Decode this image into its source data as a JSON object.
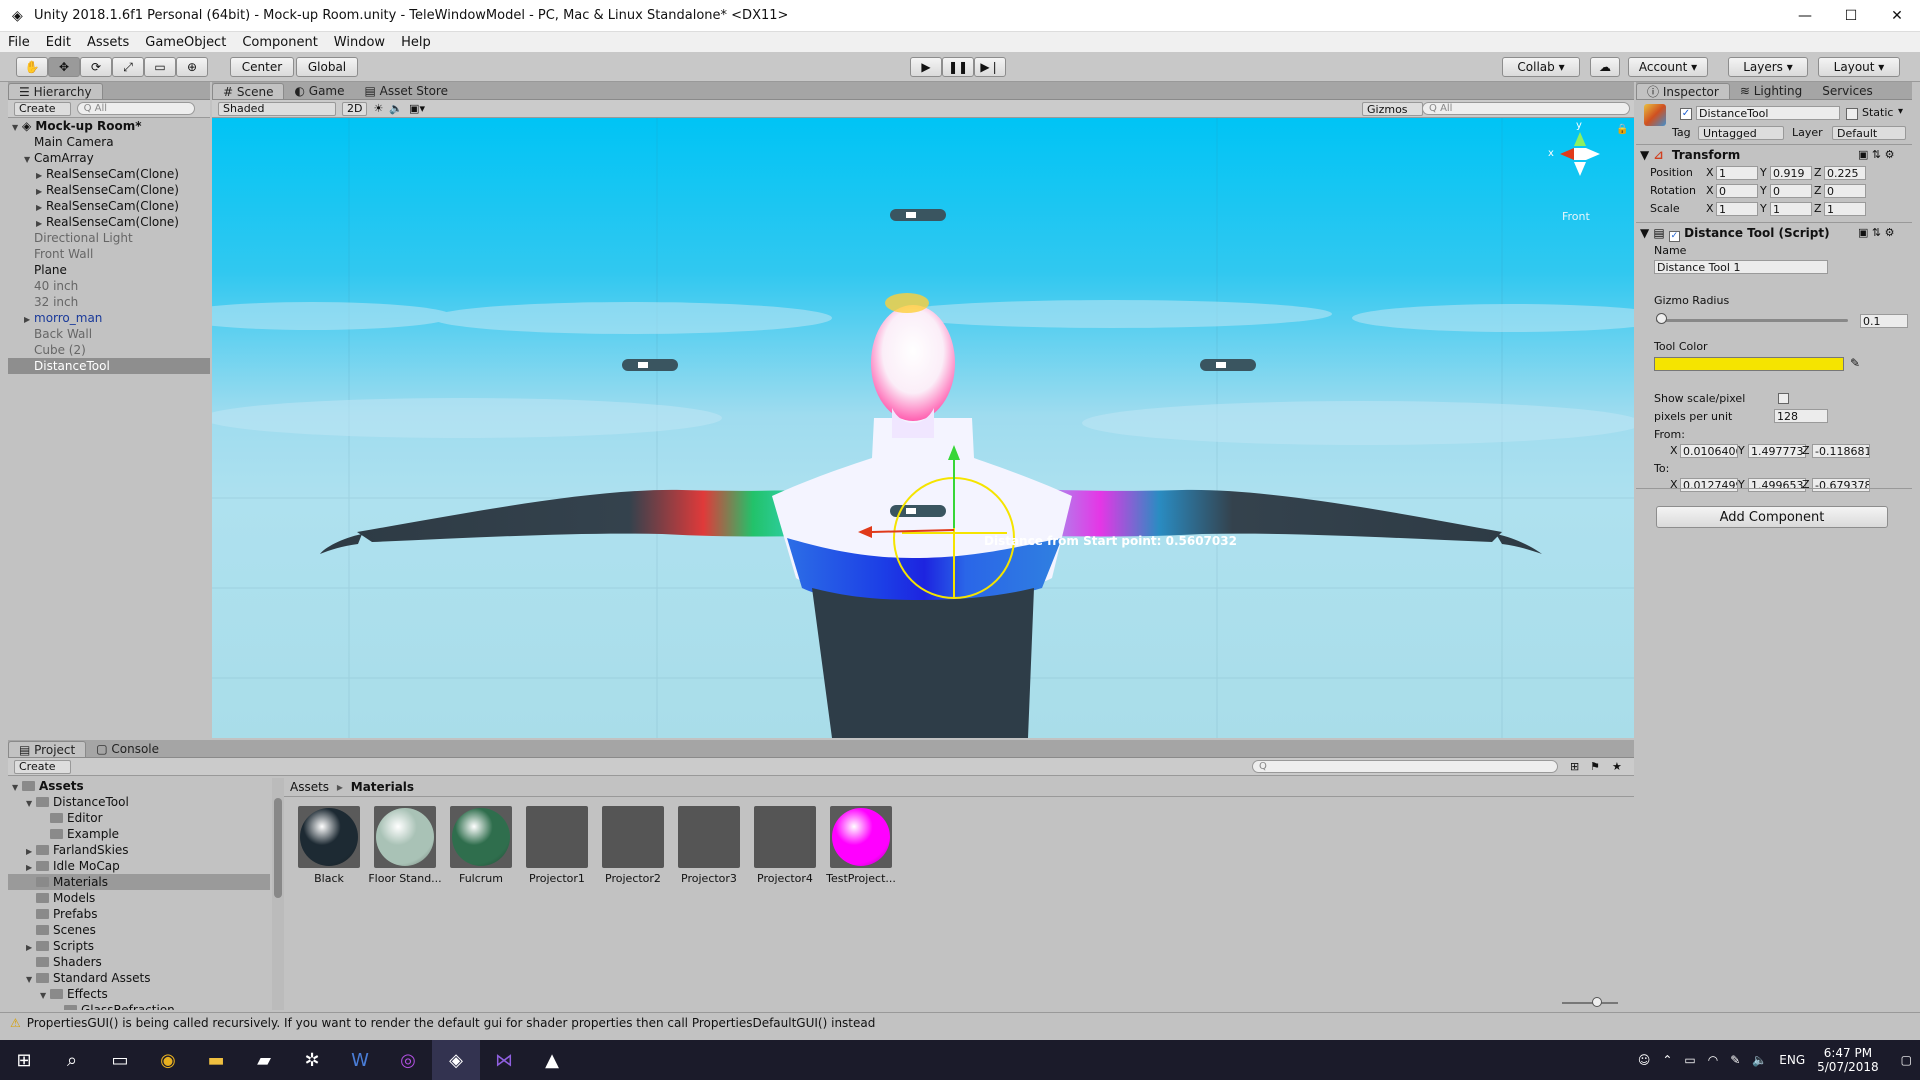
{
  "window": {
    "title": "Unity 2018.1.6f1 Personal (64bit) - Mock-up Room.unity - TeleWindowModel - PC, Mac & Linux Standalone* <DX11>",
    "minimize": "—",
    "maximize": "☐",
    "close": "✕"
  },
  "menu": [
    "File",
    "Edit",
    "Assets",
    "GameObject",
    "Component",
    "Window",
    "Help"
  ],
  "toolbar": {
    "center": "Center",
    "global": "Global",
    "collab": "Collab",
    "account": "Account",
    "layers": "Layers",
    "layout": "Layout"
  },
  "hierarchy": {
    "tab": "Hierarchy",
    "create": "Create",
    "search_placeholder": "All",
    "scene_name": "Mock-up Room*",
    "items": [
      {
        "label": "Main Camera",
        "indent": 1,
        "style": "normal"
      },
      {
        "label": "CamArray",
        "indent": 1,
        "style": "normal",
        "expanded": true
      },
      {
        "label": "RealSenseCam(Clone)",
        "indent": 2,
        "style": "normal",
        "collapsed": true
      },
      {
        "label": "RealSenseCam(Clone)",
        "indent": 2,
        "style": "normal",
        "collapsed": true
      },
      {
        "label": "RealSenseCam(Clone)",
        "indent": 2,
        "style": "normal",
        "collapsed": true
      },
      {
        "label": "RealSenseCam(Clone)",
        "indent": 2,
        "style": "normal",
        "collapsed": true
      },
      {
        "label": "Directional Light",
        "indent": 1,
        "style": "dim"
      },
      {
        "label": "Front Wall",
        "indent": 1,
        "style": "dim"
      },
      {
        "label": "Plane",
        "indent": 1,
        "style": "normal"
      },
      {
        "label": "40 inch",
        "indent": 1,
        "style": "dim"
      },
      {
        "label": "32 inch",
        "indent": 1,
        "style": "dim"
      },
      {
        "label": "morro_man",
        "indent": 1,
        "style": "blue",
        "collapsed": true
      },
      {
        "label": "Back Wall",
        "indent": 1,
        "style": "dim"
      },
      {
        "label": "Cube (2)",
        "indent": 1,
        "style": "dim"
      },
      {
        "label": "DistanceTool",
        "indent": 1,
        "style": "sel"
      }
    ]
  },
  "scene": {
    "tabs": [
      "Scene",
      "Game",
      "Asset Store"
    ],
    "shading": "Shaded",
    "mode2d": "2D",
    "gizmos": "Gizmos",
    "search_placeholder": "All",
    "view_label": "Front",
    "axis_y": "y",
    "axis_x": "x",
    "distance_label": "Distance from Start point: 0.5607032"
  },
  "inspector": {
    "tabs": [
      "Inspector",
      "Lighting",
      "Services"
    ],
    "object_name": "DistanceTool",
    "static_label": "Static",
    "tag_label": "Tag",
    "tag_value": "Untagged",
    "layer_label": "Layer",
    "layer_value": "Default",
    "transform": {
      "title": "Transform",
      "position_label": "Position",
      "rotation_label": "Rotation",
      "scale_label": "Scale",
      "position": {
        "x": "1",
        "y": "0.919",
        "z": "0.225"
      },
      "rotation": {
        "x": "0",
        "y": "0",
        "z": "0"
      },
      "scale": {
        "x": "1",
        "y": "1",
        "z": "1"
      }
    },
    "script": {
      "title": "Distance Tool (Script)",
      "name_label": "Name",
      "name_value": "Distance Tool 1",
      "gizmo_radius_label": "Gizmo Radius",
      "gizmo_radius_value": "0.1",
      "gizmo_radius_fraction": 0.0,
      "tool_color_label": "Tool Color",
      "tool_color": "#f5e400",
      "show_scale_label": "Show scale/pixel",
      "ppu_label": "pixels per unit",
      "ppu_value": "128",
      "from_label": "From:",
      "to_label": "To:",
      "from": {
        "x": "0.0106406",
        "y": "1.497773",
        "z": "-0.118681"
      },
      "to": {
        "x": "0.0127499",
        "y": "1.499653",
        "z": "-0.679378"
      }
    },
    "add_component": "Add Component"
  },
  "project": {
    "tabs": [
      "Project",
      "Console"
    ],
    "create": "Create",
    "breadcrumb_root": "Assets",
    "breadcrumb_sep": "▸",
    "breadcrumb_current": "Materials",
    "tree": [
      {
        "label": "Assets",
        "indent": 0,
        "bold": true
      },
      {
        "label": "DistanceTool",
        "indent": 1
      },
      {
        "label": "Editor",
        "indent": 2
      },
      {
        "label": "Example",
        "indent": 2
      },
      {
        "label": "FarlandSkies",
        "indent": 1
      },
      {
        "label": "Idle MoCap",
        "indent": 1
      },
      {
        "label": "Materials",
        "indent": 1,
        "selected": true
      },
      {
        "label": "Models",
        "indent": 1
      },
      {
        "label": "Prefabs",
        "indent": 1
      },
      {
        "label": "Scenes",
        "indent": 1
      },
      {
        "label": "Scripts",
        "indent": 1
      },
      {
        "label": "Shaders",
        "indent": 1
      },
      {
        "label": "Standard Assets",
        "indent": 1
      },
      {
        "label": "Effects",
        "indent": 2
      },
      {
        "label": "GlassRefraction",
        "indent": 3
      }
    ],
    "assets": [
      {
        "label": "Black",
        "kind": "sphere",
        "color": "#1d2a33"
      },
      {
        "label": "Floor Stand...",
        "kind": "sphere",
        "color": "#a9c2b6"
      },
      {
        "label": "Fulcrum",
        "kind": "sphere",
        "color": "#2f6e4d"
      },
      {
        "label": "Projector1",
        "kind": "plain",
        "color": "#555555"
      },
      {
        "label": "Projector2",
        "kind": "plain",
        "color": "#555555"
      },
      {
        "label": "Projector3",
        "kind": "plain",
        "color": "#555555"
      },
      {
        "label": "Projector4",
        "kind": "plain",
        "color": "#555555"
      },
      {
        "label": "TestProject...",
        "kind": "sphere",
        "color": "#ff00ff"
      }
    ]
  },
  "status": {
    "warning": "PropertiesGUI() is being called recursively. If you want to render the default gui for shader properties then call PropertiesDefaultGUI() instead"
  },
  "taskbar": {
    "lang": "ENG",
    "time": "6:47 PM",
    "date": "5/07/2018"
  }
}
